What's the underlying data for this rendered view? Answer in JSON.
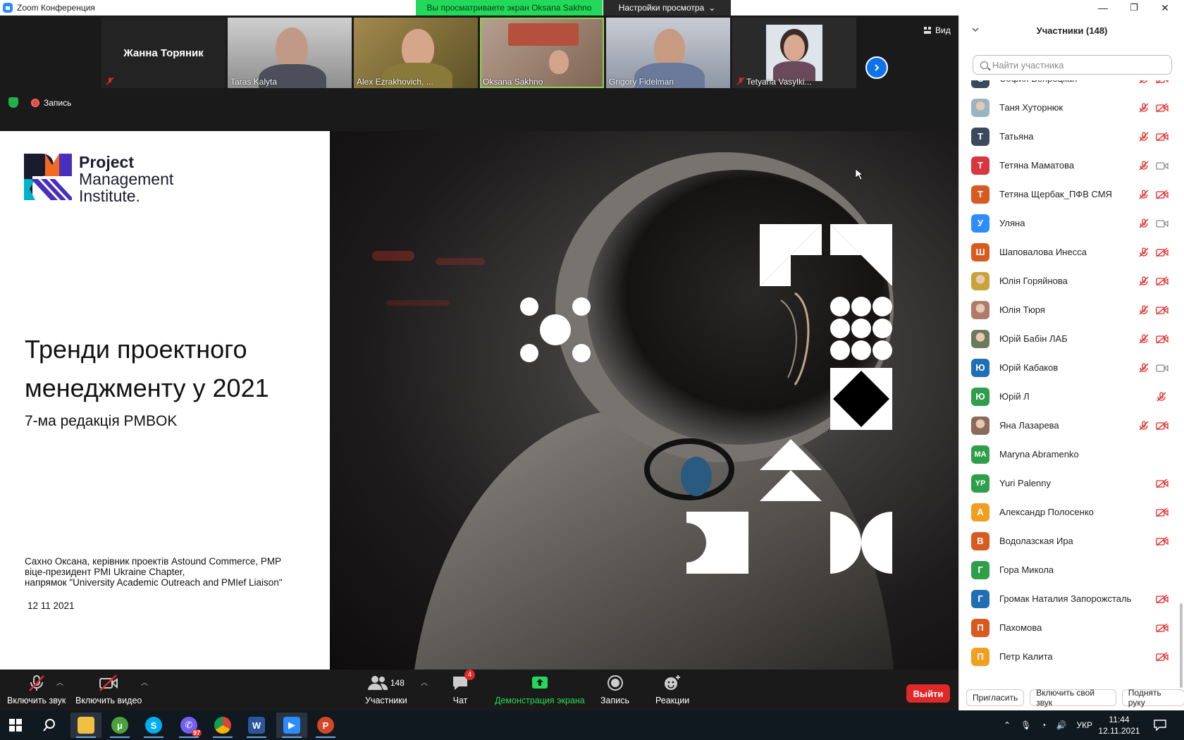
{
  "window": {
    "title": "Zoom Конференция",
    "share_banner": "Вы просматриваете экран Oksana Sakhno",
    "view_settings": "Настройки просмотра"
  },
  "video_strip": {
    "tiles": [
      {
        "name": "Жанна Торяник",
        "muted": true
      },
      {
        "name": "Taras Kalyta"
      },
      {
        "name": "Alex Ezrakhovich, ..."
      },
      {
        "name": "Oksana Sakhno",
        "active": true
      },
      {
        "name": "Grigory Fidelman"
      },
      {
        "name": "Tetyana Vasylki...",
        "muted": true
      }
    ],
    "view_label": "Вид"
  },
  "recording": {
    "label": "Запись"
  },
  "slide": {
    "logo_lines": [
      "Project",
      "Management",
      "Institute."
    ],
    "title": "Тренди проектного менеджменту у 2021",
    "subtitle": "7-ма редакція PMBOK",
    "author": "Сахно Оксана, керівник проектів Astound Commerce, PMP\n віце-президент  PMI Ukraine Chapter,\nнапрямок \"University Academic Outreach and PMIef Liaison\"",
    "date": "12 11 2021"
  },
  "toolbar": {
    "unmute": "Включить звук",
    "start_video": "Включить видео",
    "participants": "Участники",
    "participants_count": "148",
    "chat": "Чат",
    "chat_badge": "4",
    "share": "Демонстрация экрана",
    "record": "Запись",
    "reactions": "Реакции",
    "leave": "Выйти"
  },
  "panel": {
    "title": "Участники (148)",
    "search_placeholder": "Найти участника",
    "participants": [
      {
        "initial": "С",
        "name": "София Вепрецкая",
        "color": "#3a4a5c",
        "mic": "off",
        "cam": "off"
      },
      {
        "initial": "",
        "name": "Таня Хуторнюк",
        "color": "#9bb4c4",
        "photo": true,
        "mic": "off",
        "cam": "off"
      },
      {
        "initial": "Т",
        "name": "Татьяна",
        "color": "#3a4a5c",
        "mic": "off",
        "cam": "off"
      },
      {
        "initial": "Т",
        "name": "Тетяна Маматова",
        "color": "#d9363e",
        "mic": "off",
        "cam": "grey"
      },
      {
        "initial": "Т",
        "name": "Тетяна Щербак_ПФВ СМЯ",
        "color": "#d95a1f",
        "mic": "off",
        "cam": "off"
      },
      {
        "initial": "У",
        "name": "Уляна",
        "color": "#2d8cff",
        "mic": "off",
        "cam": "grey"
      },
      {
        "initial": "Ш",
        "name": "Шаповалова Инесса",
        "color": "#d95a1f",
        "mic": "off",
        "cam": "off"
      },
      {
        "initial": "",
        "name": "Юлія Горяйнова",
        "color": "#c9a23a",
        "photo": true,
        "mic": "off",
        "cam": "off"
      },
      {
        "initial": "",
        "name": "Юлія Тюря",
        "color": "#b07b6a",
        "photo": true,
        "mic": "off",
        "cam": "off"
      },
      {
        "initial": "",
        "name": "Юрій Бабін ЛАБ",
        "color": "#6b7a5a",
        "photo": true,
        "mic": "off",
        "cam": "off"
      },
      {
        "initial": "Ю",
        "name": "Юрій Кабаков",
        "color": "#1f6fb5",
        "mic": "off",
        "cam": "grey"
      },
      {
        "initial": "Ю",
        "name": "Юрій Л",
        "color": "#2e9e4a",
        "mic": "off",
        "cam": "none"
      },
      {
        "initial": "",
        "name": "Яна Лазарева",
        "color": "#8a6a5a",
        "photo": true,
        "mic": "off",
        "cam": "off"
      },
      {
        "initial": "MA",
        "name": "Maryna Abramenko",
        "color": "#2e9e4a",
        "mic": "none",
        "cam": "none"
      },
      {
        "initial": "YP",
        "name": "Yuri Palenny",
        "color": "#2e9e4a",
        "mic": "none",
        "cam": "off"
      },
      {
        "initial": "А",
        "name": "Александр Полосенко",
        "color": "#f0a020",
        "mic": "none",
        "cam": "off"
      },
      {
        "initial": "В",
        "name": "Водолазская Ира",
        "color": "#d95a1f",
        "mic": "none",
        "cam": "off"
      },
      {
        "initial": "Г",
        "name": "Гора Микола",
        "color": "#2e9e4a",
        "mic": "none",
        "cam": "none"
      },
      {
        "initial": "Г",
        "name": "Громак Наталия Запорожсталь",
        "color": "#1f6fb5",
        "mic": "none",
        "cam": "off"
      },
      {
        "initial": "П",
        "name": "Пахомова",
        "color": "#d95a1f",
        "mic": "none",
        "cam": "off"
      },
      {
        "initial": "П",
        "name": "Петр Калита",
        "color": "#f0a020",
        "mic": "none",
        "cam": "off"
      }
    ],
    "footer": {
      "invite": "Пригласить",
      "unmute_me": "Включить свой звук",
      "raise_hand": "Поднять руку"
    }
  },
  "taskbar": {
    "viber_badge": "97",
    "lang": "УКР",
    "time": "11:44",
    "date": "12.11.2021"
  }
}
